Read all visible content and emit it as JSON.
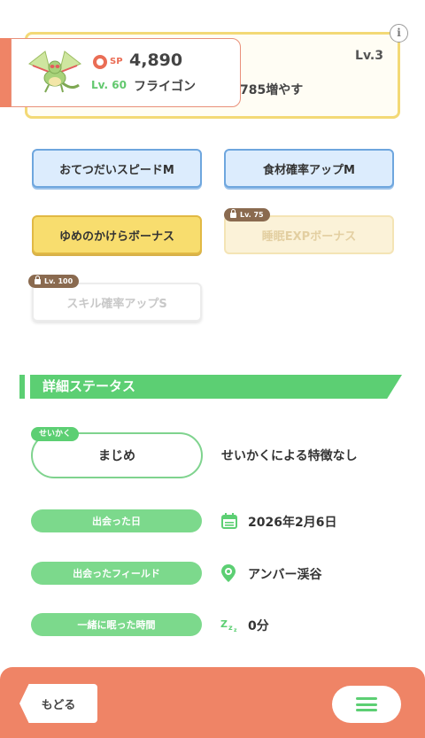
{
  "skill": {
    "level": "Lv.3",
    "desc_visible": "785増やす"
  },
  "pokemon": {
    "sp_label": "SP",
    "sp_value": "4,890",
    "level": "Lv. 60",
    "name": "フライゴン"
  },
  "subskills": [
    {
      "label": "おてつだいスピードM",
      "style": "blue",
      "locked": false
    },
    {
      "label": "食材確率アップM",
      "style": "blue",
      "locked": false
    },
    {
      "label": "ゆめのかけらボーナス",
      "style": "yellow",
      "locked": false
    },
    {
      "label": "睡眠EXPボーナス",
      "style": "yellow",
      "locked": true,
      "lock_level": "Lv. 75"
    },
    {
      "label": "スキル確率アップS",
      "style": "white",
      "locked": true,
      "lock_level": "Lv. 100"
    }
  ],
  "details": {
    "section_title": "詳細ステータス",
    "nature_tag": "せいかく",
    "nature": "まじめ",
    "nature_desc": "せいかくによる特徴なし",
    "met_date_label": "出会った日",
    "met_date": "2026年2月6日",
    "met_field_label": "出会ったフィールド",
    "met_field": "アンバー渓谷",
    "sleep_time_label": "一緒に眠った時間",
    "sleep_time": "0分"
  },
  "nav": {
    "back": "もどる"
  },
  "colors": {
    "accent_orange": "#ef8466",
    "green": "#5ccf73",
    "blue_border": "#6ea6de",
    "yellow": "#f8dd6e"
  },
  "icons": [
    "info-icon",
    "sp-icon",
    "lock-icon",
    "calendar-icon",
    "location-icon",
    "sleep-zzz-icon",
    "menu-icon"
  ]
}
